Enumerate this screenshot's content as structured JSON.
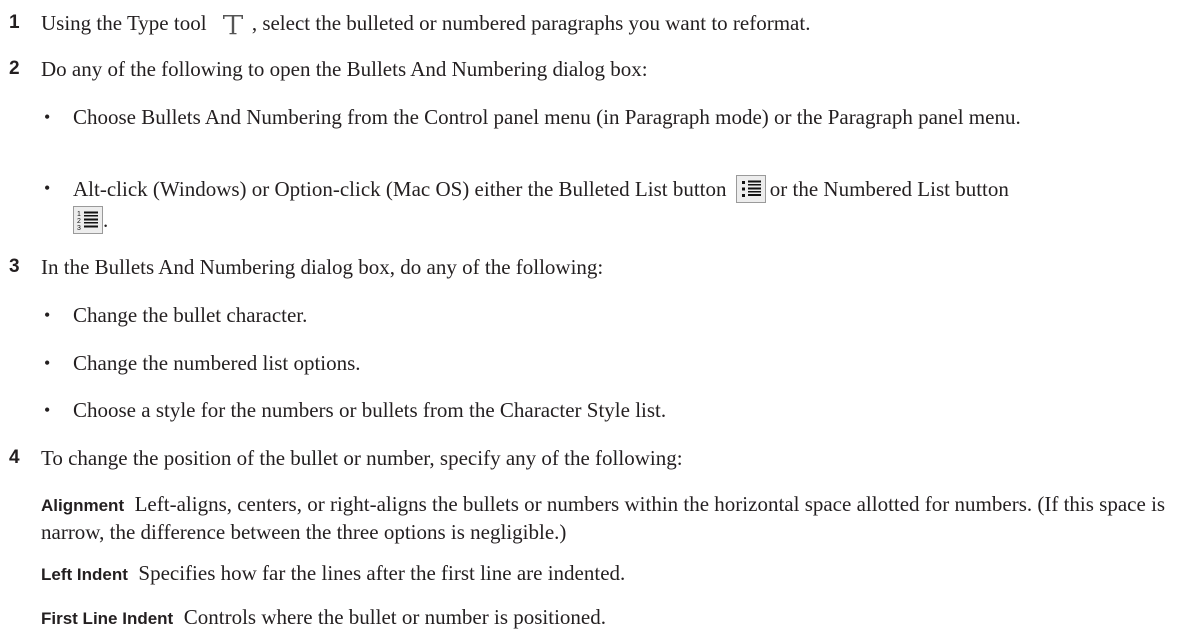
{
  "steps": [
    {
      "number": "1",
      "text_before": "Using the Type tool",
      "icon": "type-tool-icon",
      "text_after": ", select the bulleted or numbered paragraphs you want to reformat."
    },
    {
      "number": "2",
      "text": "Do any of the following to open the Bullets And Numbering dialog box:",
      "bullets": [
        {
          "text": "Choose Bullets And Numbering from the Control panel menu (in Paragraph mode) or the Paragraph panel menu."
        },
        {
          "text_before": "Alt-click (Windows) or Option-click (Mac OS) either the Bulleted List button",
          "icon1": "bulleted-list-icon",
          "text_middle": "or the Numbered List button",
          "icon2": "numbered-list-icon",
          "text_after": "."
        }
      ]
    },
    {
      "number": "3",
      "text": "In the Bullets And Numbering dialog box, do any of the following:",
      "bullets": [
        "Change the bullet character.",
        "Change the numbered list options.",
        "Choose a style for the numbers or bullets from the Character Style list."
      ]
    },
    {
      "number": "4",
      "text": "To change the position of the bullet or number, specify any of the following:",
      "definitions": [
        {
          "term": "Alignment",
          "text": "Left-aligns, centers, or right-aligns the bullets or numbers within the horizontal space allotted for numbers. (If this space is narrow, the difference between the three options is negligible.)"
        },
        {
          "term": "Left Indent",
          "text": "Specifies how far the lines after the first line are indented."
        },
        {
          "term": "First Line Indent",
          "text": "Controls where the bullet or number is positioned."
        }
      ]
    }
  ],
  "bullet_glyph": "•"
}
